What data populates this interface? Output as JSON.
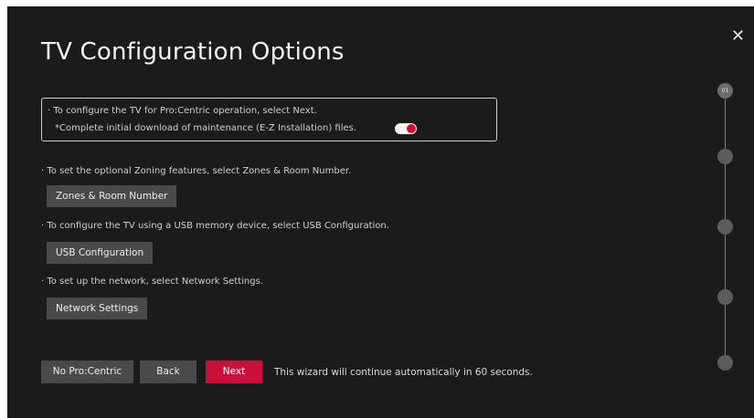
{
  "dialog": {
    "title": "TV Configuration Options",
    "close_glyph": "✕"
  },
  "config_box": {
    "line1": "· To configure the TV for Pro:Centric operation, select Next.",
    "line2": "*Complete initial download of maintenance (E-Z Installation) files.",
    "toggle_on": true
  },
  "zoning": {
    "description": "· To set the optional Zoning features, select Zones & Room Number.",
    "button_label": "Zones & Room Number"
  },
  "usb": {
    "description": "· To configure the TV using a USB memory device, select USB Configuration.",
    "button_label": "USB Configuration"
  },
  "network": {
    "description": "· To set up the network, select Network Settings.",
    "button_label": "Network Settings"
  },
  "footer": {
    "no_procentric_label": "No Pro:Centric",
    "back_label": "Back",
    "next_label": "Next",
    "auto_note": "This wizard will continue automatically in 60 seconds."
  },
  "stepper": {
    "active_step_label": "01",
    "total_steps": 5
  },
  "colors": {
    "background": "#1b1b1b",
    "accent": "#c8103a",
    "button": "#4a4a4a"
  }
}
